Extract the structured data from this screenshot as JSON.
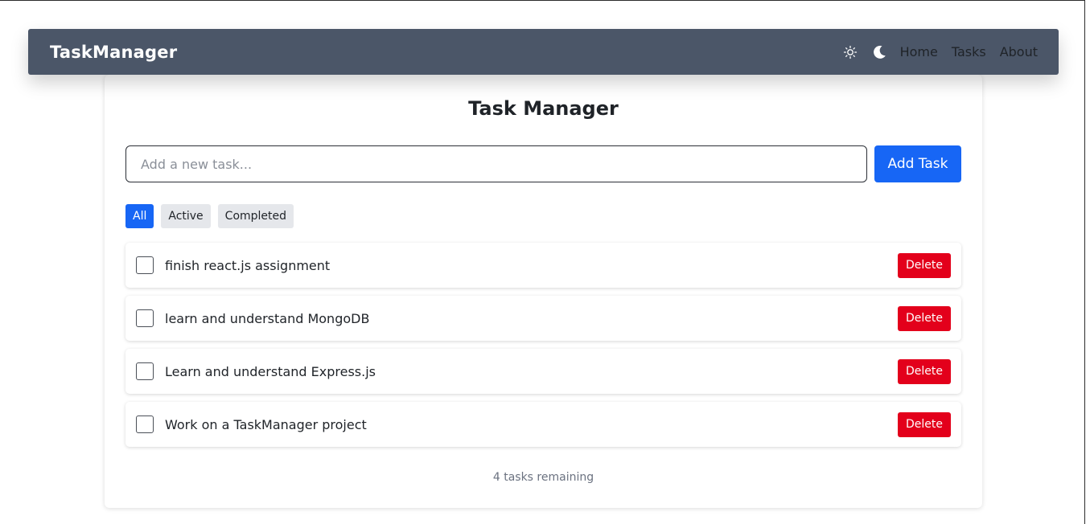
{
  "navbar": {
    "brand": "TaskManager",
    "links": [
      "Home",
      "Tasks",
      "About"
    ],
    "icons": [
      "sun-icon",
      "moon-icon"
    ]
  },
  "main": {
    "title": "Task Manager",
    "input_placeholder": "Add a new task...",
    "input_value": "",
    "add_button": "Add Task",
    "filters": [
      "All",
      "Active",
      "Completed"
    ],
    "active_filter": "All",
    "tasks": [
      {
        "text": "finish react.js assignment",
        "completed": false,
        "delete_label": "Delete"
      },
      {
        "text": "learn and understand MongoDB",
        "completed": false,
        "delete_label": "Delete"
      },
      {
        "text": "Learn and understand Express.js",
        "completed": false,
        "delete_label": "Delete"
      },
      {
        "text": "Work on a TaskManager project",
        "completed": false,
        "delete_label": "Delete"
      }
    ],
    "footer_text": "4 tasks remaining"
  },
  "colors": {
    "navbar_bg": "#4b5668",
    "primary": "#1766f5",
    "danger": "#e3001b",
    "filter_bg": "#e5e7eb"
  }
}
